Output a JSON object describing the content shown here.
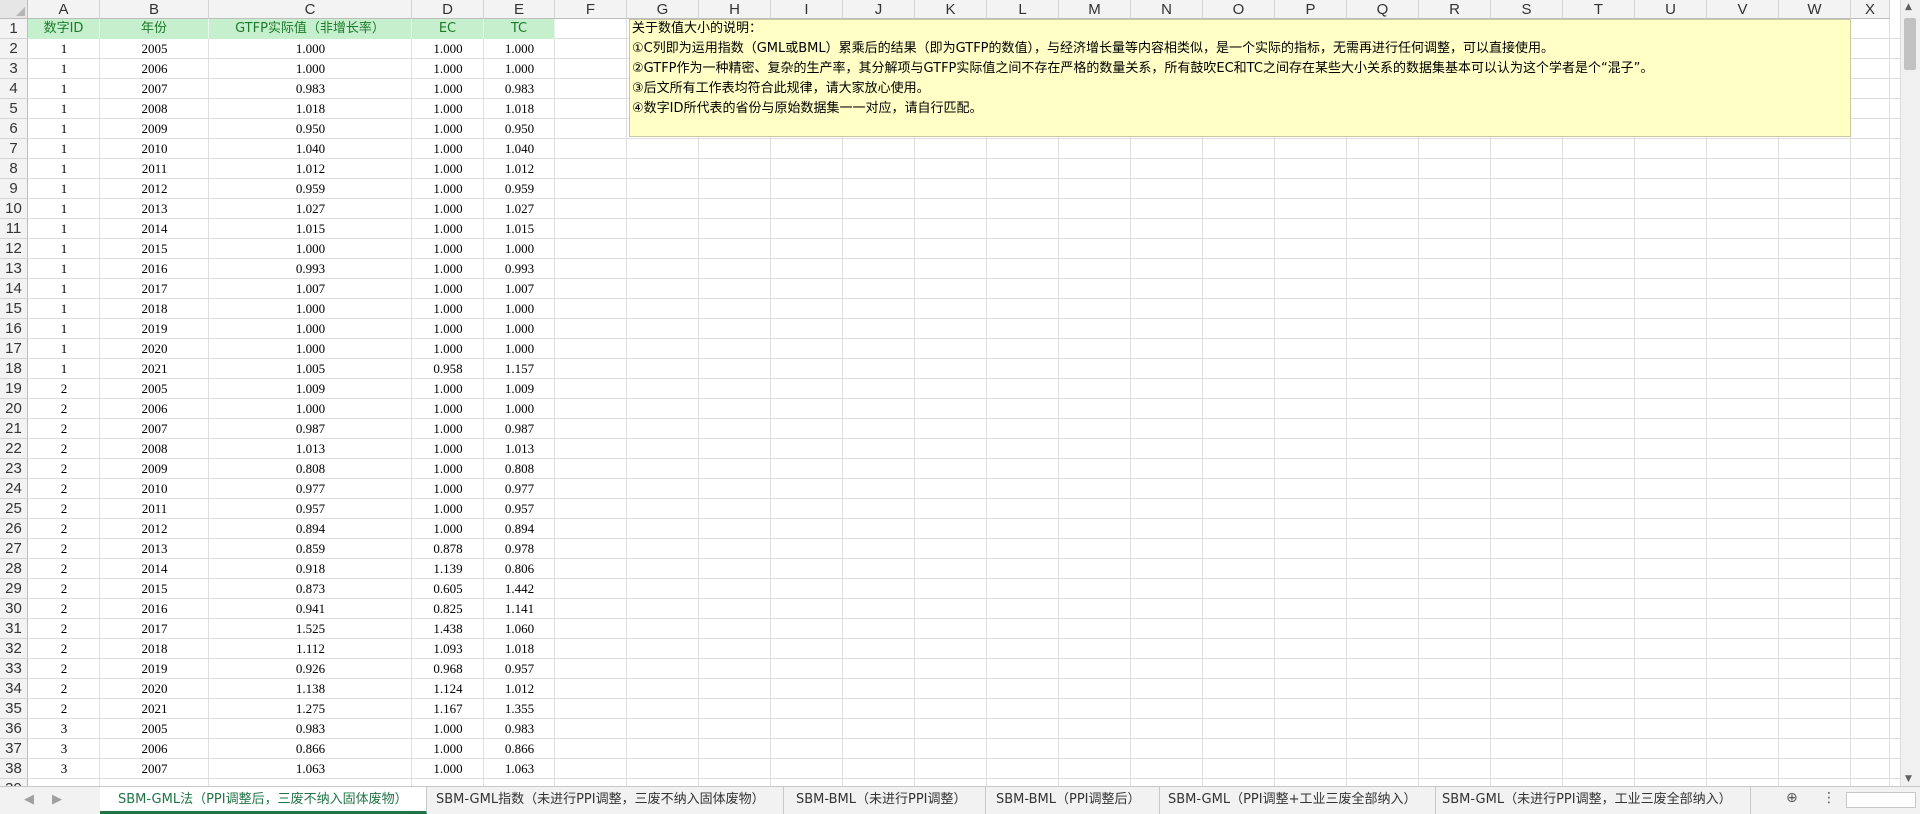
{
  "columns": [
    "A",
    "B",
    "C",
    "D",
    "E",
    "F",
    "G",
    "H",
    "I",
    "J",
    "K",
    "L",
    "M",
    "N",
    "O",
    "P",
    "Q",
    "R",
    "S",
    "T",
    "U",
    "V",
    "W",
    "X"
  ],
  "header_row": [
    "数字ID",
    "年份",
    "GTFP实际值（非增长率）",
    "EC",
    "TC"
  ],
  "rows": [
    [
      "1",
      "2005",
      "1.000",
      "1.000",
      "1.000"
    ],
    [
      "1",
      "2006",
      "1.000",
      "1.000",
      "1.000"
    ],
    [
      "1",
      "2007",
      "0.983",
      "1.000",
      "0.983"
    ],
    [
      "1",
      "2008",
      "1.018",
      "1.000",
      "1.018"
    ],
    [
      "1",
      "2009",
      "0.950",
      "1.000",
      "0.950"
    ],
    [
      "1",
      "2010",
      "1.040",
      "1.000",
      "1.040"
    ],
    [
      "1",
      "2011",
      "1.012",
      "1.000",
      "1.012"
    ],
    [
      "1",
      "2012",
      "0.959",
      "1.000",
      "0.959"
    ],
    [
      "1",
      "2013",
      "1.027",
      "1.000",
      "1.027"
    ],
    [
      "1",
      "2014",
      "1.015",
      "1.000",
      "1.015"
    ],
    [
      "1",
      "2015",
      "1.000",
      "1.000",
      "1.000"
    ],
    [
      "1",
      "2016",
      "0.993",
      "1.000",
      "0.993"
    ],
    [
      "1",
      "2017",
      "1.007",
      "1.000",
      "1.007"
    ],
    [
      "1",
      "2018",
      "1.000",
      "1.000",
      "1.000"
    ],
    [
      "1",
      "2019",
      "1.000",
      "1.000",
      "1.000"
    ],
    [
      "1",
      "2020",
      "1.000",
      "1.000",
      "1.000"
    ],
    [
      "1",
      "2021",
      "1.005",
      "0.958",
      "1.157"
    ],
    [
      "2",
      "2005",
      "1.009",
      "1.000",
      "1.009"
    ],
    [
      "2",
      "2006",
      "1.000",
      "1.000",
      "1.000"
    ],
    [
      "2",
      "2007",
      "0.987",
      "1.000",
      "0.987"
    ],
    [
      "2",
      "2008",
      "1.013",
      "1.000",
      "1.013"
    ],
    [
      "2",
      "2009",
      "0.808",
      "1.000",
      "0.808"
    ],
    [
      "2",
      "2010",
      "0.977",
      "1.000",
      "0.977"
    ],
    [
      "2",
      "2011",
      "0.957",
      "1.000",
      "0.957"
    ],
    [
      "2",
      "2012",
      "0.894",
      "1.000",
      "0.894"
    ],
    [
      "2",
      "2013",
      "0.859",
      "0.878",
      "0.978"
    ],
    [
      "2",
      "2014",
      "0.918",
      "1.139",
      "0.806"
    ],
    [
      "2",
      "2015",
      "0.873",
      "0.605",
      "1.442"
    ],
    [
      "2",
      "2016",
      "0.941",
      "0.825",
      "1.141"
    ],
    [
      "2",
      "2017",
      "1.525",
      "1.438",
      "1.060"
    ],
    [
      "2",
      "2018",
      "1.112",
      "1.093",
      "1.018"
    ],
    [
      "2",
      "2019",
      "0.926",
      "0.968",
      "0.957"
    ],
    [
      "2",
      "2020",
      "1.138",
      "1.124",
      "1.012"
    ],
    [
      "2",
      "2021",
      "1.275",
      "1.167",
      "1.355"
    ],
    [
      "3",
      "2005",
      "0.983",
      "1.000",
      "0.983"
    ],
    [
      "3",
      "2006",
      "0.866",
      "1.000",
      "0.866"
    ],
    [
      "3",
      "2007",
      "1.063",
      "1.000",
      "1.063"
    ]
  ],
  "note_lines": [
    "关于数值大小的说明：",
    "①C列即为运用指数（GML或BML）累乘后的结果（即为GTFP的数值），与经济增长量等内容相类似，是一个实际的指标，无需再进行任何调整，可以直接使用。",
    "②GTFP作为一种精密、复杂的生产率，其分解项与GTFP实际值之间不存在严格的数量关系，所有鼓吹EC和TC之间存在某些大小关系的数据集基本可以认为这个学者是个“混子”。",
    "③后文所有工作表均符合此规律，请大家放心使用。",
    "④数字ID所代表的省份与原始数据集一一对应，请自行匹配。"
  ],
  "sheet_tabs": [
    "SBM-GML法（PPI调整后，三废不纳入固体废物）",
    "SBM-GML指数（未进行PPI调整，三废不纳入固体废物）",
    "SBM-BML（未进行PPI调整）",
    "SBM-BML（PPI调整后）",
    "SBM-GML（PPI调整+工业三废全部纳入）",
    "SBM-GML（未进行PPI调整，工业三废全部纳入）"
  ],
  "active_tab": 0,
  "colors": {
    "header_fill": "#c6efce",
    "header_text": "#1d7a2a",
    "note_fill": "#ffffc6",
    "tab_active": "#217346"
  },
  "icons": [
    "select-all-corner-icon",
    "tab-scroll-left-icon",
    "tab-scroll-right-icon",
    "add-sheet-icon",
    "more-options-icon",
    "scroll-up-icon",
    "scroll-down-icon"
  ]
}
